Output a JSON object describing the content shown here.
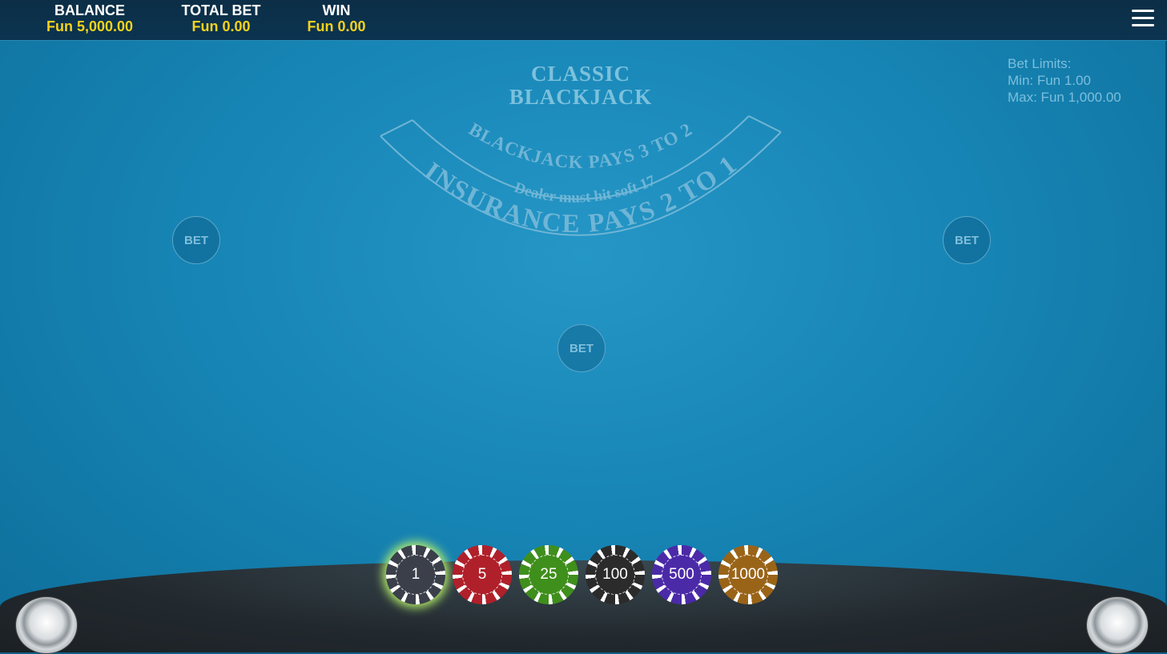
{
  "header": {
    "balance_label": "BALANCE",
    "balance_value": "Fun 5,000.00",
    "total_bet_label": "TOTAL BET",
    "total_bet_value": "Fun 0.00",
    "win_label": "WIN",
    "win_value": "Fun 0.00",
    "menu_icon": "hamburger-menu-icon"
  },
  "table": {
    "title_line1": "CLASSIC",
    "title_line2": "BLACKJACK",
    "arc_text_blackjack": "BLACKJACK PAYS 3 TO 2",
    "arc_text_dealer": "Dealer must hit soft 17",
    "arc_text_insurance": "INSURANCE PAYS 2 TO 1"
  },
  "bet_limits": {
    "heading": "Bet Limits:",
    "min": "Min: Fun 1.00",
    "max": "Max: Fun 1,000.00"
  },
  "bet_spots": [
    "BET",
    "BET",
    "BET"
  ],
  "chips": [
    {
      "label": "1",
      "color": "#3a3f4a",
      "selected": true
    },
    {
      "label": "5",
      "color": "#b0202a",
      "selected": false
    },
    {
      "label": "25",
      "color": "#3f8f1c",
      "selected": false
    },
    {
      "label": "100",
      "color": "#2b2b2b",
      "selected": false
    },
    {
      "label": "500",
      "color": "#4b2aa8",
      "selected": false
    },
    {
      "label": "1000",
      "color": "#9a6418",
      "selected": false
    }
  ],
  "colors": {
    "accent_value": "#f5d21c",
    "felt": "#1786b6"
  }
}
